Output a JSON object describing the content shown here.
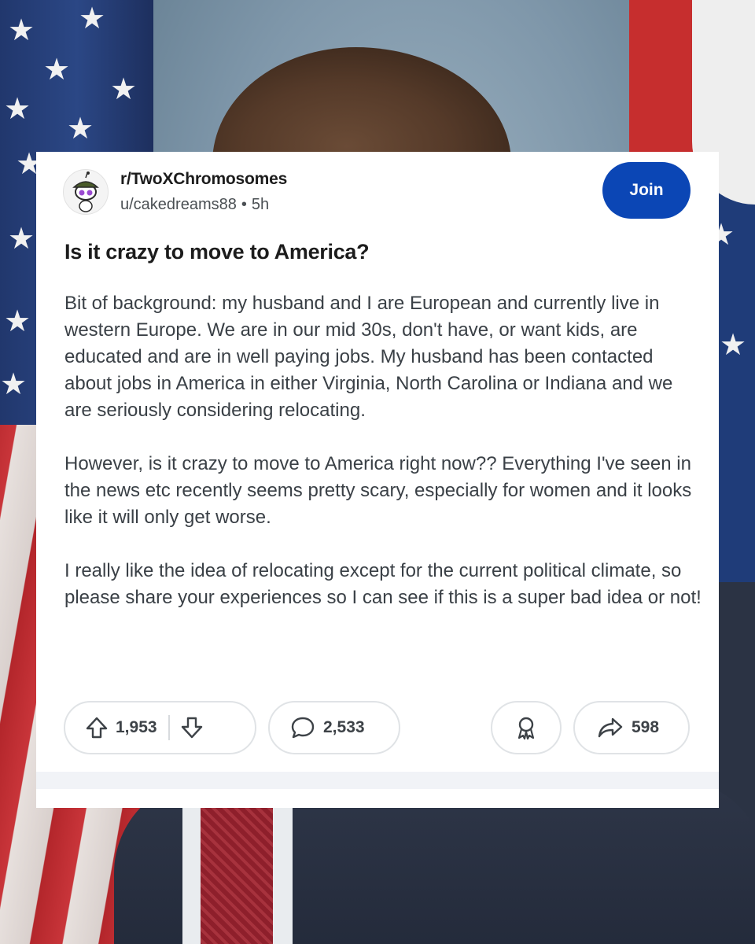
{
  "post": {
    "subreddit": "r/TwoXChromosomes",
    "author": "u/cakedreams88",
    "separator": "•",
    "age": "5h",
    "join_label": "Join",
    "title": "Is it crazy to move to America?",
    "paragraphs": [
      "Bit of background: my husband and I are European and currently live in western Europe. We are in our mid 30s, don't have, or want kids, are educated and are in well paying jobs. My husband has been contacted about jobs in America in either Virginia, North Carolina or Indiana and we are seriously considering relocating.",
      "However, is it crazy to move to America right now?? Everything I've seen in the news etc recently seems pretty scary, especially for women and it looks like it will only get worse.",
      "I really like the idea of relocating except for the current political climate, so please share your experiences so I can see if this is a super bad idea or not!"
    ],
    "upvotes": "1,953",
    "comments": "2,533",
    "shares": "598"
  },
  "icons": {
    "avatar": "snoo-avatar-icon",
    "upvote": "upvote-arrow-icon",
    "downvote": "downvote-arrow-icon",
    "comment": "comment-bubble-icon",
    "award": "award-ribbon-icon",
    "share": "share-arrow-icon"
  },
  "colors": {
    "join_button": "#0b46b5",
    "card_background": "#ffffff",
    "body_text": "#3a4046"
  }
}
